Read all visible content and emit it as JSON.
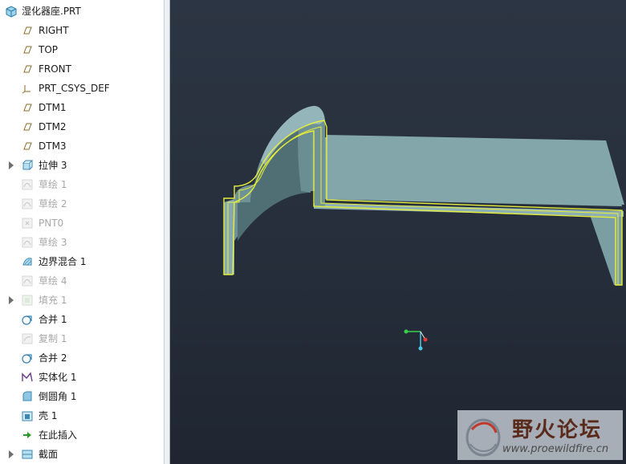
{
  "tree": {
    "root_label": "湿化器座.PRT",
    "items": [
      {
        "label": "RIGHT",
        "icon": "datum-plane-icon",
        "dim": false,
        "expandable": false
      },
      {
        "label": "TOP",
        "icon": "datum-plane-icon",
        "dim": false,
        "expandable": false
      },
      {
        "label": "FRONT",
        "icon": "datum-plane-icon",
        "dim": false,
        "expandable": false
      },
      {
        "label": "PRT_CSYS_DEF",
        "icon": "csys-icon",
        "dim": false,
        "expandable": false
      },
      {
        "label": "DTM1",
        "icon": "datum-plane-icon",
        "dim": false,
        "expandable": false
      },
      {
        "label": "DTM2",
        "icon": "datum-plane-icon",
        "dim": false,
        "expandable": false
      },
      {
        "label": "DTM3",
        "icon": "datum-plane-icon",
        "dim": false,
        "expandable": false
      },
      {
        "label": "拉伸 3",
        "icon": "extrude-icon",
        "dim": false,
        "expandable": true
      },
      {
        "label": "草绘 1",
        "icon": "sketch-icon",
        "dim": true,
        "expandable": false
      },
      {
        "label": "草绘 2",
        "icon": "sketch-icon",
        "dim": true,
        "expandable": false
      },
      {
        "label": "PNT0",
        "icon": "datum-point-icon",
        "dim": true,
        "expandable": false
      },
      {
        "label": "草绘 3",
        "icon": "sketch-icon",
        "dim": true,
        "expandable": false
      },
      {
        "label": "边界混合 1",
        "icon": "boundary-blend-icon",
        "dim": false,
        "expandable": false
      },
      {
        "label": "草绘 4",
        "icon": "sketch-icon",
        "dim": true,
        "expandable": false
      },
      {
        "label": "填充 1",
        "icon": "fill-icon",
        "dim": true,
        "expandable": true
      },
      {
        "label": "合并 1",
        "icon": "merge-icon",
        "dim": false,
        "expandable": false
      },
      {
        "label": "复制 1",
        "icon": "copy-icon",
        "dim": true,
        "expandable": false
      },
      {
        "label": "合并 2",
        "icon": "merge-icon",
        "dim": false,
        "expandable": false
      },
      {
        "label": "实体化 1",
        "icon": "solidify-icon",
        "dim": false,
        "expandable": false
      },
      {
        "label": "倒圆角 1",
        "icon": "round-icon",
        "dim": false,
        "expandable": false
      },
      {
        "label": "壳 1",
        "icon": "shell-icon",
        "dim": false,
        "expandable": false
      },
      {
        "label": "在此插入",
        "icon": "insert-here-arrow-icon",
        "dim": false,
        "expandable": false
      },
      {
        "label": "截面",
        "icon": "section-icon",
        "dim": false,
        "expandable": true
      }
    ]
  },
  "viewport": {
    "model_color": "#7fa5a8",
    "edge_highlight_color": "#e8ef3a"
  },
  "watermark": {
    "title": "野火论坛",
    "url": "www.proewildfire.cn"
  }
}
